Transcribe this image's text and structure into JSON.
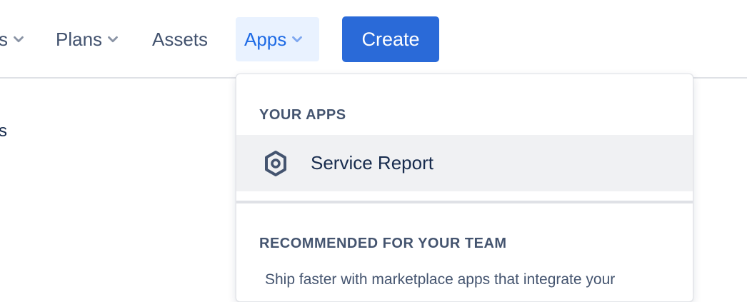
{
  "nav": {
    "partial_item_label": "s",
    "plans_label": "Plans",
    "assets_label": "Assets",
    "apps_label": "Apps",
    "create_label": "Create"
  },
  "side": {
    "partial_label": "s"
  },
  "apps_dropdown": {
    "your_apps_heading": "YOUR APPS",
    "apps": [
      {
        "label": "Service Report",
        "icon": "hexagon-gear-icon"
      }
    ],
    "recommended_heading": "RECOMMENDED FOR YOUR TEAM",
    "recommended_text": "Ship faster with marketplace apps that integrate your"
  },
  "colors": {
    "primary": "#2a6ad8",
    "apps_active_bg": "#e9f2ff",
    "apps_active_text": "#1d6ae5",
    "nav_text": "#42526e",
    "selected_row_bg": "#f0f1f3"
  }
}
